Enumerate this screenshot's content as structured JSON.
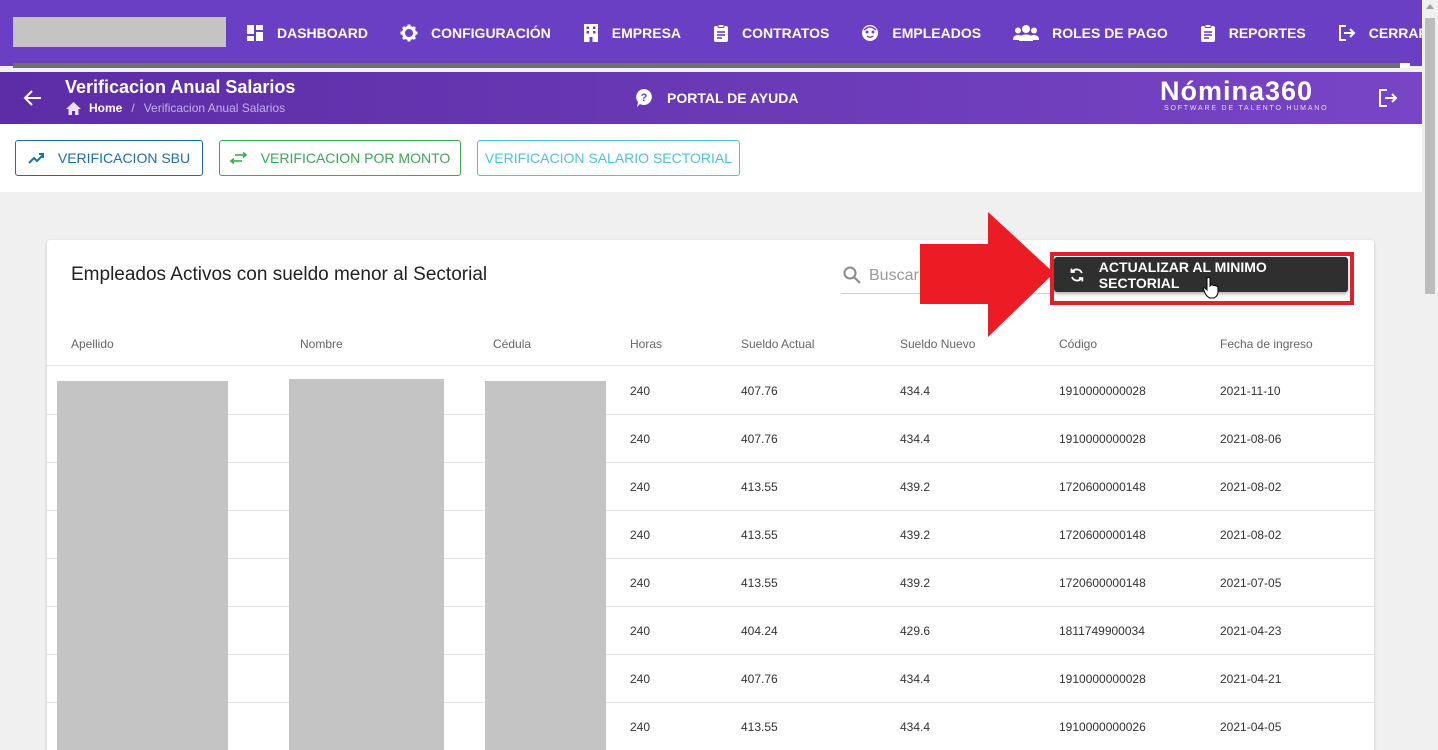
{
  "topnav": {
    "items": [
      {
        "label": "DASHBOARD",
        "icon": "dashboard-icon"
      },
      {
        "label": "CONFIGURACIÓN",
        "icon": "gear-icon"
      },
      {
        "label": "EMPRESA",
        "icon": "building-icon"
      },
      {
        "label": "CONTRATOS",
        "icon": "clipboard-icon"
      },
      {
        "label": "EMPLEADOS",
        "icon": "face-icon"
      },
      {
        "label": "ROLES DE PAGO",
        "icon": "users-icon"
      },
      {
        "label": "REPORTES",
        "icon": "clipboard-icon"
      },
      {
        "label": "CERRAR SESIÓ",
        "icon": "logout-icon"
      }
    ]
  },
  "subheader": {
    "title": "Verificacion Anual Salarios",
    "breadcrumb": {
      "home": "Home",
      "separator": "/",
      "current": "Verificacion Anual Salarios"
    },
    "help_label": "PORTAL DE AYUDA",
    "brand_name": "Nómina360",
    "brand_tagline": "SOFTWARE DE TALENTO HUMANO"
  },
  "actions": {
    "sbu_label": "VERIFICACION SBU",
    "monto_label": "VERIFICACION POR MONTO",
    "sectorial_label": "VERIFICACION SALARIO SECTORIAL"
  },
  "card": {
    "title": "Empleados Activos con sueldo menor al Sectorial",
    "search_placeholder": "Buscar",
    "update_label": "ACTUALIZAR AL MINIMO SECTORIAL",
    "columns": [
      "Apellido",
      "Nombre",
      "Cédula",
      "Horas",
      "Sueldo Actual",
      "Sueldo Nuevo",
      "Código",
      "Fecha de ingreso"
    ],
    "rows": [
      {
        "horas": "240",
        "actual": "407.76",
        "nuevo": "434.4",
        "codigo": "1910000000028",
        "fecha": "2021-11-10"
      },
      {
        "horas": "240",
        "actual": "407.76",
        "nuevo": "434.4",
        "codigo": "1910000000028",
        "fecha": "2021-08-06"
      },
      {
        "horas": "240",
        "actual": "413.55",
        "nuevo": "439.2",
        "codigo": "1720600000148",
        "fecha": "2021-08-02"
      },
      {
        "horas": "240",
        "actual": "413.55",
        "nuevo": "439.2",
        "codigo": "1720600000148",
        "fecha": "2021-08-02"
      },
      {
        "horas": "240",
        "actual": "413.55",
        "nuevo": "439.2",
        "codigo": "1720600000148",
        "fecha": "2021-07-05"
      },
      {
        "horas": "240",
        "actual": "404.24",
        "nuevo": "429.6",
        "codigo": "1811749900034",
        "fecha": "2021-04-23"
      },
      {
        "horas": "240",
        "actual": "407.76",
        "nuevo": "434.4",
        "codigo": "1910000000028",
        "fecha": "2021-04-21"
      },
      {
        "horas": "240",
        "actual": "413.55",
        "nuevo": "434.4",
        "codigo": "1910000000026",
        "fecha": "2021-04-05"
      }
    ]
  },
  "colors": {
    "nav_bg": "#6b3fc4",
    "subheader_bg": "#5c2da6",
    "sbu": "#1a6fa6",
    "monto": "#3aa856",
    "sectorial": "#4fc3d6",
    "highlight": "#e0202a"
  }
}
